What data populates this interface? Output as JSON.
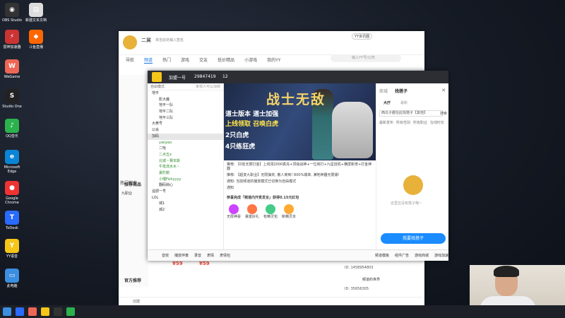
{
  "desktop": {
    "icons": [
      {
        "label": "OBS Studio",
        "color": "#333",
        "glyph": "◉"
      },
      {
        "label": "新建文本文档",
        "color": "#ddd",
        "glyph": "▤"
      },
      {
        "label": "雷神加速器",
        "color": "#c33",
        "glyph": "⚡"
      },
      {
        "label": "斗鱼直播",
        "color": "#f60",
        "glyph": "◆"
      },
      {
        "label": "WeGame",
        "color": "#e65",
        "glyph": "W"
      },
      {
        "label": "Studio One",
        "color": "#222",
        "glyph": "S"
      },
      {
        "label": "QQ音乐",
        "color": "#2bb24c",
        "glyph": "♪"
      },
      {
        "label": "Microsoft Edge",
        "color": "#0a84d6",
        "glyph": "e"
      },
      {
        "label": "Google Chrome",
        "color": "#e33",
        "glyph": "●"
      },
      {
        "label": "ToDesk",
        "color": "#2a6bff",
        "glyph": "T"
      },
      {
        "label": "YY语音",
        "color": "#f5c518",
        "glyph": "Y"
      },
      {
        "label": "此电脑",
        "color": "#3b8ee0",
        "glyph": "▭"
      }
    ]
  },
  "yy_main": {
    "user_name": "二翼",
    "signature": "单击此处输入签名",
    "badge": "YY资讯圈",
    "search_placeholder": "输入YY号/公司",
    "nav": [
      "导航",
      "频道",
      "热门",
      "游戏",
      "交友",
      "低价精品",
      "小游戏",
      "我的YY"
    ],
    "left_items": [
      "热门搜索",
      "九职业"
    ],
    "recommend_title": "推荐商品",
    "prices": [
      "¥59",
      "¥59"
    ],
    "official_title": "官方推荐",
    "bottom_label": "创建",
    "user_ids": [
      "ID: 1458954803",
      "ID: 35656305"
    ],
    "channel_hint": "频道的世界"
  },
  "channel": {
    "room_name": "加盟一号",
    "room_id": "29847419",
    "online_count": "12",
    "sidebar_header": "自由模式",
    "sidebar_header_right": "率领人可以加频",
    "tree": [
      {
        "label": "地平",
        "level": 0
      },
      {
        "label": "影大魔",
        "level": 1
      },
      {
        "label": "地平一队",
        "level": 1
      },
      {
        "label": "地平二队",
        "level": 1
      },
      {
        "label": "地平三队",
        "level": 1
      },
      {
        "label": "大黄号",
        "level": 0
      },
      {
        "label": "公会",
        "level": 0
      },
      {
        "label": "加码",
        "level": 0,
        "selected": true
      },
      {
        "label": "yaoyao",
        "level": 1,
        "green": true
      },
      {
        "label": "二哈",
        "level": 1
      },
      {
        "label": "二点五x",
        "level": 1,
        "green": true
      },
      {
        "label": "北城丶赛本斯",
        "level": 1,
        "green": true
      },
      {
        "label": "牛批流水水丶",
        "level": 1,
        "green": true
      },
      {
        "label": "夏盯鹅",
        "level": 1,
        "green": true
      },
      {
        "label": "小哩Fishyyyy",
        "level": 1,
        "green": true
      },
      {
        "label": "翻码倘心",
        "level": 1
      },
      {
        "label": "遥颁一号",
        "level": 0
      },
      {
        "label": "LOL",
        "level": 0
      },
      {
        "label": "城1",
        "level": 1
      },
      {
        "label": "城2",
        "level": 1
      }
    ],
    "video_title": "战士无敌",
    "video_lines": [
      "道士版本 道士加强",
      "上线领取 召唤白虎",
      "2只白虎",
      "4只练狂虎"
    ],
    "chat": [
      "推荐: 【0氪无限打金】上线领2000真充+顶级战神+一位商打+九星挂机+横屏新宠+打金神器",
      "推荐: 【超变九职业】无限抽奖, 散人爽到! 800%爆率, 满地神器无限爆!",
      "通知: 当前频道的播放模式已切换为自由模式",
      "通知",
      "恭喜完成「频道内开麦发言」获得0.15元红包"
    ],
    "bottom_bar": [
      "音效",
      "播放伴奏",
      "录音",
      "表情",
      "表情包"
    ],
    "gift_labels": [
      "无限神豪",
      "暴富好礼",
      "有精灵包",
      "新精灵本"
    ],
    "find_tab_a": "商城",
    "find_tab_b": "找搭子",
    "sub_tabs": [
      "大厅",
      "最新"
    ],
    "filter_text": "西瓜子都在此找搭子【其他】",
    "filter_right": "搜索",
    "filters": [
      "最新发布",
      "所有性别",
      "所有职业",
      "在线时长"
    ],
    "empty_text": "这里还没有搭子哦~",
    "find_button": "我要找搭子",
    "bottom_right": [
      "频道模板",
      "组件广告",
      "游戏商城",
      "游戏加速"
    ]
  },
  "colors": {
    "accent": "#1a8cff",
    "yy_yellow": "#f5c518",
    "price_red": "#e43"
  }
}
